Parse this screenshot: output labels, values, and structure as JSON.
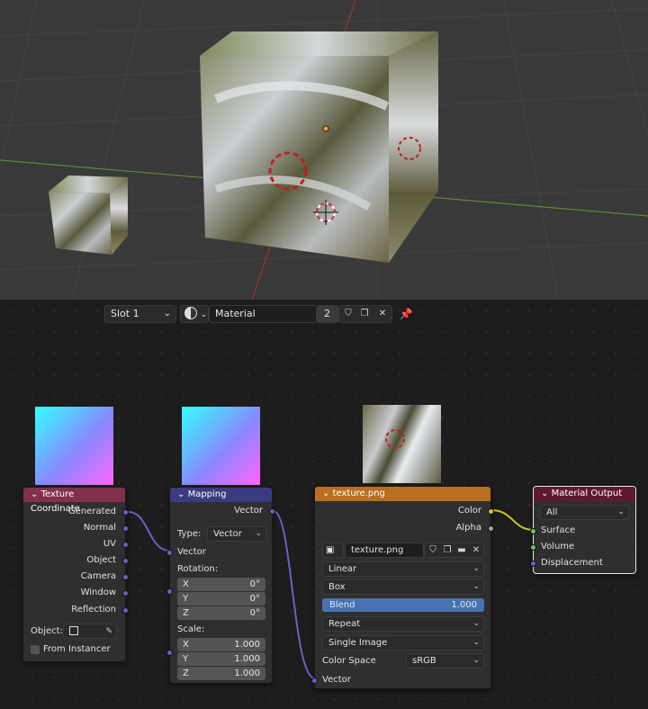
{
  "header": {
    "slot": "Slot 1",
    "material_name": "Material",
    "user_count": "2"
  },
  "nodes": {
    "texture_coordinate": {
      "title": "Texture Coordinate",
      "outputs": [
        "Generated",
        "Normal",
        "UV",
        "Object",
        "Camera",
        "Window",
        "Reflection"
      ],
      "object_label": "Object:",
      "from_instancer": "From Instancer"
    },
    "mapping": {
      "title": "Mapping",
      "output": "Vector",
      "type_label": "Type:",
      "type_value": "Vector",
      "input_vector": "Vector",
      "rotation_label": "Rotation:",
      "rotation": [
        {
          "axis": "X",
          "value": "0°"
        },
        {
          "axis": "Y",
          "value": "0°"
        },
        {
          "axis": "Z",
          "value": "0°"
        }
      ],
      "scale_label": "Scale:",
      "scale": [
        {
          "axis": "X",
          "value": "1.000"
        },
        {
          "axis": "Y",
          "value": "1.000"
        },
        {
          "axis": "Z",
          "value": "1.000"
        }
      ]
    },
    "image_texture": {
      "title": "texture.png",
      "output_color": "Color",
      "output_alpha": "Alpha",
      "image_name": "texture.png",
      "interpolation": "Linear",
      "projection": "Box",
      "blend_label": "Blend",
      "blend_value": "1.000",
      "blend_fraction": 1.0,
      "extension": "Repeat",
      "source": "Single Image",
      "color_space_label": "Color Space",
      "color_space": "sRGB",
      "input_vector": "Vector"
    },
    "material_output": {
      "title": "Material Output",
      "target": "All",
      "inputs": [
        "Surface",
        "Volume",
        "Displacement"
      ]
    }
  },
  "colors": {
    "input_node_header": "#83314a",
    "vector_node_header": "#3b3b82",
    "texture_node_header": "#ba6e20",
    "output_node_header": "#5e1a2f",
    "vector_socket": "#6363c7",
    "color_socket": "#c7c729",
    "shader_socket": "#63c763",
    "blend_bar": "#4772b3"
  }
}
